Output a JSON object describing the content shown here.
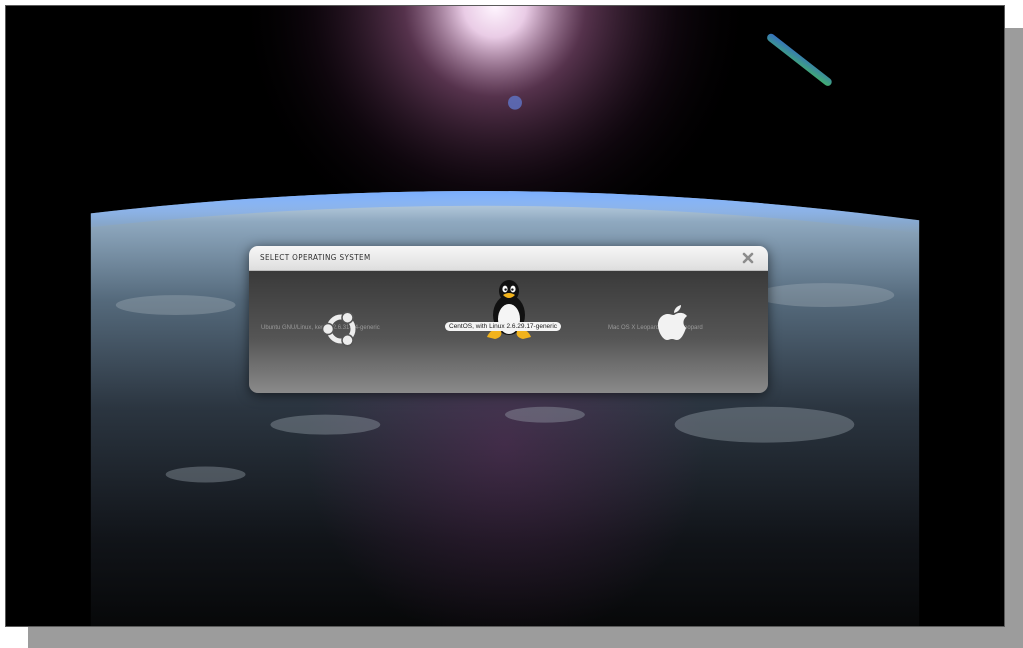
{
  "dialog": {
    "title": "SELECT OPERATING SYSTEM",
    "close_icon": "close-x-icon"
  },
  "os_options": [
    {
      "label": "Ubuntu GNU/Linux, kernel 2.6.31-14-generic",
      "icon": "ubuntu-icon",
      "selected": false
    },
    {
      "label": "CentOS, with Linux 2.6.29.17-generic",
      "icon": "tux-penguin-icon",
      "selected": true
    },
    {
      "label": "Mac OS X Leopard / Snow Leopard",
      "icon": "apple-icon",
      "selected": false
    }
  ],
  "colors": {
    "dialog_title_bg": "#e8e8e8",
    "dialog_body_top": "#3a3a3a",
    "dialog_body_bottom": "#8a8a8a",
    "selected_label_bg": "#f4f4f4"
  }
}
